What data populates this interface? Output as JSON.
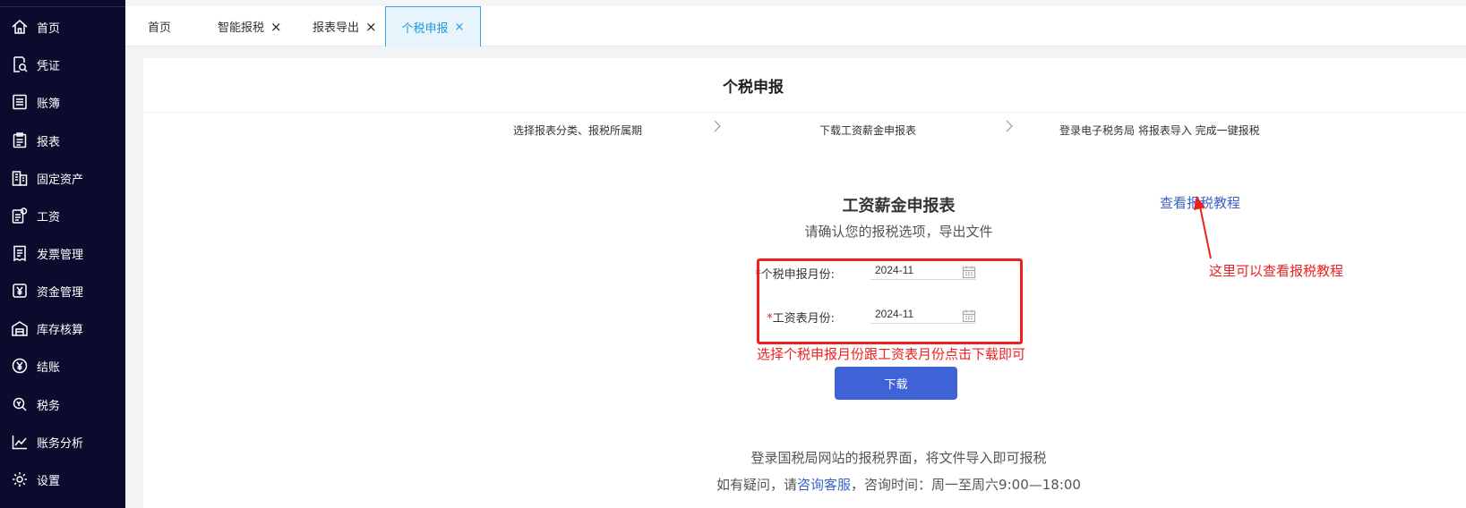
{
  "sidebar": {
    "items": [
      {
        "label": "首页",
        "icon": "home-icon"
      },
      {
        "label": "凭证",
        "icon": "voucher-search-icon"
      },
      {
        "label": "账簿",
        "icon": "ledger-icon"
      },
      {
        "label": "报表",
        "icon": "clipboard-icon"
      },
      {
        "label": "固定资产",
        "icon": "building-icon"
      },
      {
        "label": "工资",
        "icon": "salary-icon"
      },
      {
        "label": "发票管理",
        "icon": "invoice-icon"
      },
      {
        "label": "资金管理",
        "icon": "yen-box-icon"
      },
      {
        "label": "库存核算",
        "icon": "warehouse-icon"
      },
      {
        "label": "结账",
        "icon": "yen-circle-icon"
      },
      {
        "label": "税务",
        "icon": "tax-icon"
      },
      {
        "label": "账务分析",
        "icon": "chart-line-icon"
      },
      {
        "label": "设置",
        "icon": "gear-icon"
      }
    ]
  },
  "tabs": [
    {
      "label": "首页",
      "closable": false
    },
    {
      "label": "智能报税",
      "closable": true
    },
    {
      "label": "报表导出",
      "closable": true
    },
    {
      "label": "个税申报",
      "closable": true,
      "active": true
    }
  ],
  "tab_close": "×",
  "page": {
    "title": "个税申报",
    "steps": [
      "选择报表分类、报税所属期",
      "下载工资薪金申报表",
      "登录电子税务局 将报表导入 完成一键报税"
    ],
    "form_title": "工资薪金申报表",
    "form_subtitle": "请确认您的报税选项，导出文件",
    "tutorial_link": "查看报税教程",
    "required_mark": "*",
    "fields": [
      {
        "label": "个税申报月份:",
        "value": "2024-11"
      },
      {
        "label": "工资表月份:",
        "value": "2024-11"
      }
    ],
    "download_button": "下载",
    "info_line1": "登录国税局网站的报税界面，将文件导入即可报税",
    "info_line2_prefix": "如有疑问，请",
    "info_line2_link": "咨询客服",
    "info_line2_suffix": "，咨询时间：周一至周六9:00—18:00"
  },
  "annotations": {
    "tutorial_note": "这里可以查看报税教程",
    "select_note": "选择个税申报月份跟工资表月份点击下载即可"
  },
  "colors": {
    "sidebar_bg": "#0b0b2e",
    "active_tab": "#1a9ae0",
    "primary_button": "#3f63d6",
    "link": "#3b62c9",
    "annotation": "#ee2020"
  }
}
